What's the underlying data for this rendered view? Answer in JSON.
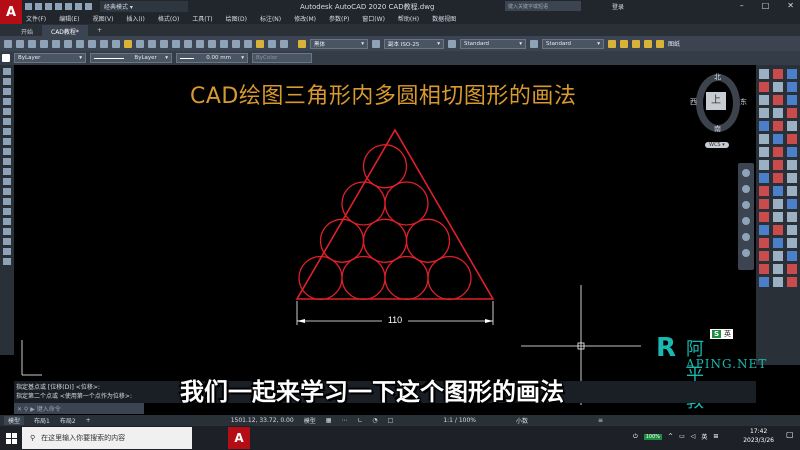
{
  "titlebar": {
    "app_icon": "A",
    "workspace": "经典模式",
    "title": "Autodesk AutoCAD 2020    CAD教程.dwg",
    "search_placeholder": "键入关键字或短语",
    "login": "登录"
  },
  "menu": [
    "文件(F)",
    "编辑(E)",
    "视图(V)",
    "插入(I)",
    "格式(O)",
    "工具(T)",
    "绘图(D)",
    "标注(N)",
    "修改(M)",
    "参数(P)",
    "窗口(W)",
    "帮助(H)",
    "数据视图"
  ],
  "tabs": [
    "开始",
    "CAD教程*"
  ],
  "toolbar": {
    "font": "黑体",
    "dimstyle": "副本 ISO-25",
    "tablestyle": "Standard",
    "mleaderstyle": "Standard",
    "layer_label": "图纸"
  },
  "properties": {
    "layer": "ByLayer",
    "linetype": "ByLayer",
    "lineweight": "0.00 mm",
    "color": "ByColor"
  },
  "drawing": {
    "heading": "CAD绘图三角形内多圆相切图形的画法",
    "dimension": "110",
    "line_color": "#e0202a",
    "heading_color": "#d89a2e"
  },
  "viewcube": {
    "north": "北",
    "south": "南",
    "east": "东",
    "west": "西",
    "top": "上",
    "wcs": "WCS"
  },
  "subtitle": "我们一起来学习一下这个图形的画法",
  "watermark": {
    "cn": "阿平教程",
    "en": "APING.NET"
  },
  "ime": {
    "s": "S",
    "lang": "英"
  },
  "command": {
    "line1": "指定基点或 [位移(D)] <位移>:",
    "line2": "指定第二个点或 <使用第一个点作为位移>:",
    "input_placeholder": "键入命令"
  },
  "status": {
    "model_tab": "模型",
    "layout1": "布局1",
    "layout2": "布局2",
    "coords": "1501.12, 33.72, 0.00",
    "model_label": "模型",
    "scale": "1:1 / 100%",
    "units": "小数"
  },
  "taskbar": {
    "search_placeholder": "在这里输入你要搜索的内容",
    "app": "A",
    "battery": "100%",
    "lang": "英",
    "time": "17:42",
    "date": "2023/3/26"
  }
}
